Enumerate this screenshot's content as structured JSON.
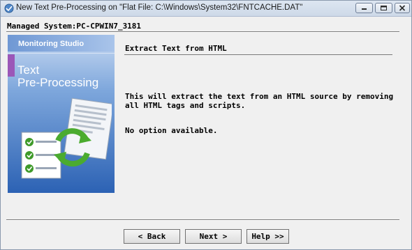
{
  "window": {
    "title": "New Text Pre-Processing on \"Flat File: C:\\Windows\\System32\\FNTCACHE.DAT\"",
    "controls": [
      "minimize-icon",
      "maximize-icon",
      "close-icon"
    ]
  },
  "header": {
    "managed_system": "Managed System:PC-CPWIN7_3181"
  },
  "side_panel": {
    "brand": "Monitoring Studio",
    "title_line1": "Text",
    "title_line2": "Pre-Processing",
    "icon": "document-refresh-checklist-icon"
  },
  "content": {
    "section_title": "Extract Text from HTML",
    "description": "This will extract the text from an HTML source by removing all HTML tags and scripts.",
    "no_option": "No option available."
  },
  "buttons": {
    "back": "< Back",
    "next": "Next >",
    "help": "Help >>"
  },
  "colors": {
    "panel_top": "#dfe9f7",
    "panel_bottom": "#2f6ec0",
    "accent_bar": "#9b57b8",
    "check_green": "#3f9a2a"
  }
}
